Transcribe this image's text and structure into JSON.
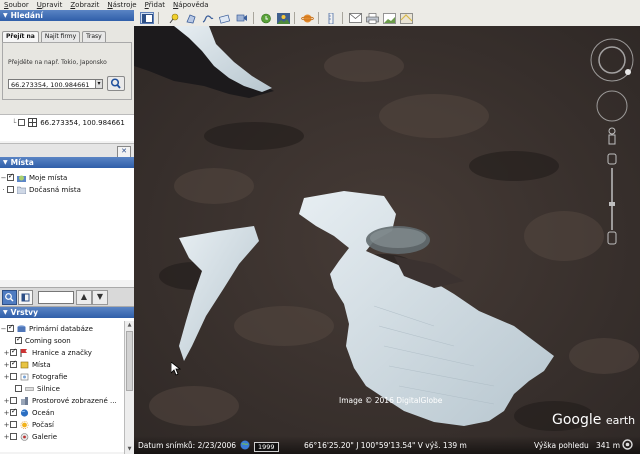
{
  "menu": [
    "Soubor",
    "Upravit",
    "Zobrazit",
    "Nástroje",
    "Přidat",
    "Nápověda"
  ],
  "search": {
    "title": "Hledání",
    "tabs": [
      "Přejít na",
      "Najít firmy",
      "Trasy"
    ],
    "hint": "Přejděte na např. Tokio, Japonsko",
    "value": "66.273354, 100.984661"
  },
  "results": {
    "item": "66.273354, 100.984661"
  },
  "places": {
    "title": "Místa",
    "items": [
      "Moje místa",
      "Dočasná místa"
    ]
  },
  "layers": {
    "title": "Vrstvy",
    "items": [
      "Primární databáze",
      "Coming soon",
      "Hranice a značky",
      "Místa",
      "Fotografie",
      "Silnice",
      "Prostorové zobrazené ...",
      "Oceán",
      "Počasí",
      "Galerie"
    ]
  },
  "map": {
    "credit": "Image © 2016 DigitalGlobe",
    "date_label": "Datum snímků: 2/23/2006",
    "year_badge": "1999",
    "coords": "66°16'25.20\" J  100°59'13.54\" V  výš.   139 m",
    "eye_alt_label": "Výška pohledu",
    "eye_alt_value": "341 m",
    "logo_word1": "Google",
    "logo_word2": "earth"
  },
  "colors": {
    "panel_header": "#3d6ab5",
    "map_rock": "#3a322f",
    "ice": "#c9d5dc",
    "menubar": "#ecebe6"
  }
}
